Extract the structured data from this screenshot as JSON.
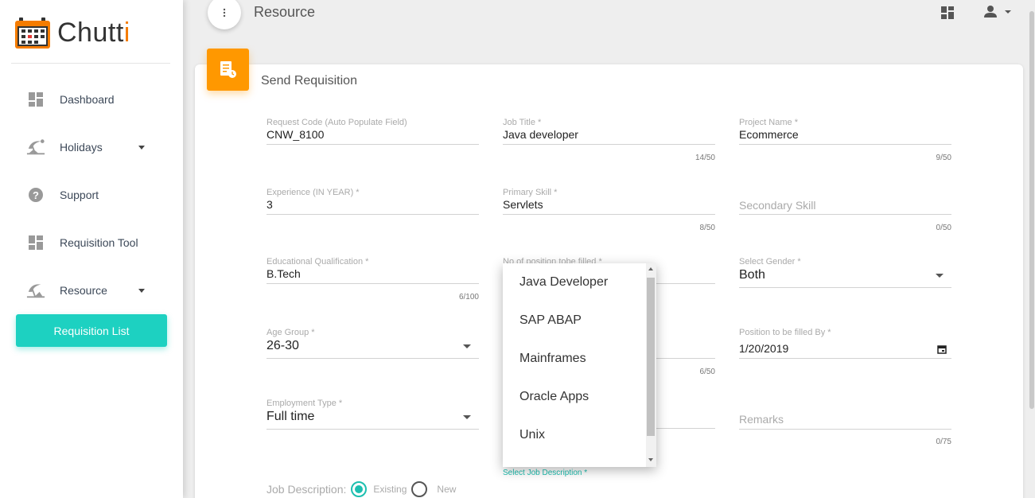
{
  "app": {
    "brand_prefix": "Chutt",
    "brand_accent": "i",
    "accent_color": "#1dd1c1",
    "brand_color": "#f57c00"
  },
  "sidebar": {
    "items": [
      {
        "label": "Dashboard",
        "icon": "dashboard-icon"
      },
      {
        "label": "Holidays",
        "icon": "beach-icon"
      },
      {
        "label": "Support",
        "icon": "help-icon"
      },
      {
        "label": "Requisition Tool",
        "icon": "dashboard-icon"
      },
      {
        "label": "Resource",
        "icon": "beach-icon"
      }
    ],
    "active_item": "Requisition List"
  },
  "topbar": {
    "title": "Resource"
  },
  "card": {
    "title": "Send Requisition"
  },
  "form": {
    "request_code": {
      "label": "Request Code (Auto Populate Field)",
      "value": "CNW_8100"
    },
    "job_title": {
      "label": "Job Title *",
      "value": "Java developer",
      "count": "14/50"
    },
    "project_name": {
      "label": "Project Name *",
      "value": "Ecommerce",
      "count": "9/50"
    },
    "experience": {
      "label": "Experience (IN YEAR) *",
      "value": "3"
    },
    "primary_skill": {
      "label": "Primary Skill *",
      "value": "Servlets",
      "count": "8/50"
    },
    "secondary_skill": {
      "placeholder": "Secondary Skill",
      "count": "0/50"
    },
    "education": {
      "label": "Educational Qualification *",
      "value": "B.Tech",
      "count": "6/100"
    },
    "positions": {
      "label": "No of position tobe filled *"
    },
    "gender": {
      "label": "Select Gender *",
      "value": "Both"
    },
    "age_group": {
      "label": "Age Group *",
      "value": "26-30"
    },
    "middle_count": "6/50",
    "filled_by": {
      "label": "Position to be filled By *",
      "value": "1/20/2019"
    },
    "employment_type": {
      "label": "Employment Type *",
      "value": "Full time"
    },
    "remarks": {
      "placeholder": "Remarks",
      "count": "0/75"
    },
    "select_job_description": "Select Job Description *",
    "job_description": {
      "label": "Job Description:",
      "options": [
        "Existing",
        "New"
      ],
      "selected": "Existing"
    }
  },
  "job_dropdown": {
    "options": [
      "Java Developer",
      "SAP ABAP",
      "Mainframes",
      "Oracle Apps",
      "Unix"
    ]
  }
}
